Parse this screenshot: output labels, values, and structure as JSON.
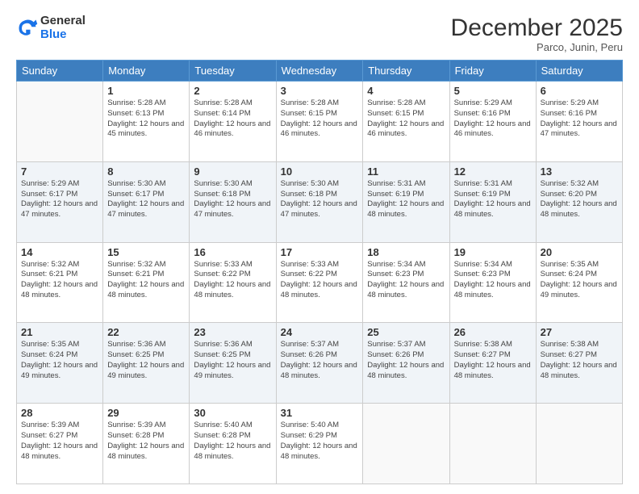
{
  "logo": {
    "general": "General",
    "blue": "Blue"
  },
  "header": {
    "title": "December 2025",
    "subtitle": "Parco, Junin, Peru"
  },
  "weekdays": [
    "Sunday",
    "Monday",
    "Tuesday",
    "Wednesday",
    "Thursday",
    "Friday",
    "Saturday"
  ],
  "weeks": [
    [
      {
        "day": "",
        "sunrise": "",
        "sunset": "",
        "daylight": ""
      },
      {
        "day": "1",
        "sunrise": "Sunrise: 5:28 AM",
        "sunset": "Sunset: 6:13 PM",
        "daylight": "Daylight: 12 hours and 45 minutes."
      },
      {
        "day": "2",
        "sunrise": "Sunrise: 5:28 AM",
        "sunset": "Sunset: 6:14 PM",
        "daylight": "Daylight: 12 hours and 46 minutes."
      },
      {
        "day": "3",
        "sunrise": "Sunrise: 5:28 AM",
        "sunset": "Sunset: 6:15 PM",
        "daylight": "Daylight: 12 hours and 46 minutes."
      },
      {
        "day": "4",
        "sunrise": "Sunrise: 5:28 AM",
        "sunset": "Sunset: 6:15 PM",
        "daylight": "Daylight: 12 hours and 46 minutes."
      },
      {
        "day": "5",
        "sunrise": "Sunrise: 5:29 AM",
        "sunset": "Sunset: 6:16 PM",
        "daylight": "Daylight: 12 hours and 46 minutes."
      },
      {
        "day": "6",
        "sunrise": "Sunrise: 5:29 AM",
        "sunset": "Sunset: 6:16 PM",
        "daylight": "Daylight: 12 hours and 47 minutes."
      }
    ],
    [
      {
        "day": "7",
        "sunrise": "Sunrise: 5:29 AM",
        "sunset": "Sunset: 6:17 PM",
        "daylight": "Daylight: 12 hours and 47 minutes."
      },
      {
        "day": "8",
        "sunrise": "Sunrise: 5:30 AM",
        "sunset": "Sunset: 6:17 PM",
        "daylight": "Daylight: 12 hours and 47 minutes."
      },
      {
        "day": "9",
        "sunrise": "Sunrise: 5:30 AM",
        "sunset": "Sunset: 6:18 PM",
        "daylight": "Daylight: 12 hours and 47 minutes."
      },
      {
        "day": "10",
        "sunrise": "Sunrise: 5:30 AM",
        "sunset": "Sunset: 6:18 PM",
        "daylight": "Daylight: 12 hours and 47 minutes."
      },
      {
        "day": "11",
        "sunrise": "Sunrise: 5:31 AM",
        "sunset": "Sunset: 6:19 PM",
        "daylight": "Daylight: 12 hours and 48 minutes."
      },
      {
        "day": "12",
        "sunrise": "Sunrise: 5:31 AM",
        "sunset": "Sunset: 6:19 PM",
        "daylight": "Daylight: 12 hours and 48 minutes."
      },
      {
        "day": "13",
        "sunrise": "Sunrise: 5:32 AM",
        "sunset": "Sunset: 6:20 PM",
        "daylight": "Daylight: 12 hours and 48 minutes."
      }
    ],
    [
      {
        "day": "14",
        "sunrise": "Sunrise: 5:32 AM",
        "sunset": "Sunset: 6:21 PM",
        "daylight": "Daylight: 12 hours and 48 minutes."
      },
      {
        "day": "15",
        "sunrise": "Sunrise: 5:32 AM",
        "sunset": "Sunset: 6:21 PM",
        "daylight": "Daylight: 12 hours and 48 minutes."
      },
      {
        "day": "16",
        "sunrise": "Sunrise: 5:33 AM",
        "sunset": "Sunset: 6:22 PM",
        "daylight": "Daylight: 12 hours and 48 minutes."
      },
      {
        "day": "17",
        "sunrise": "Sunrise: 5:33 AM",
        "sunset": "Sunset: 6:22 PM",
        "daylight": "Daylight: 12 hours and 48 minutes."
      },
      {
        "day": "18",
        "sunrise": "Sunrise: 5:34 AM",
        "sunset": "Sunset: 6:23 PM",
        "daylight": "Daylight: 12 hours and 48 minutes."
      },
      {
        "day": "19",
        "sunrise": "Sunrise: 5:34 AM",
        "sunset": "Sunset: 6:23 PM",
        "daylight": "Daylight: 12 hours and 48 minutes."
      },
      {
        "day": "20",
        "sunrise": "Sunrise: 5:35 AM",
        "sunset": "Sunset: 6:24 PM",
        "daylight": "Daylight: 12 hours and 49 minutes."
      }
    ],
    [
      {
        "day": "21",
        "sunrise": "Sunrise: 5:35 AM",
        "sunset": "Sunset: 6:24 PM",
        "daylight": "Daylight: 12 hours and 49 minutes."
      },
      {
        "day": "22",
        "sunrise": "Sunrise: 5:36 AM",
        "sunset": "Sunset: 6:25 PM",
        "daylight": "Daylight: 12 hours and 49 minutes."
      },
      {
        "day": "23",
        "sunrise": "Sunrise: 5:36 AM",
        "sunset": "Sunset: 6:25 PM",
        "daylight": "Daylight: 12 hours and 49 minutes."
      },
      {
        "day": "24",
        "sunrise": "Sunrise: 5:37 AM",
        "sunset": "Sunset: 6:26 PM",
        "daylight": "Daylight: 12 hours and 48 minutes."
      },
      {
        "day": "25",
        "sunrise": "Sunrise: 5:37 AM",
        "sunset": "Sunset: 6:26 PM",
        "daylight": "Daylight: 12 hours and 48 minutes."
      },
      {
        "day": "26",
        "sunrise": "Sunrise: 5:38 AM",
        "sunset": "Sunset: 6:27 PM",
        "daylight": "Daylight: 12 hours and 48 minutes."
      },
      {
        "day": "27",
        "sunrise": "Sunrise: 5:38 AM",
        "sunset": "Sunset: 6:27 PM",
        "daylight": "Daylight: 12 hours and 48 minutes."
      }
    ],
    [
      {
        "day": "28",
        "sunrise": "Sunrise: 5:39 AM",
        "sunset": "Sunset: 6:27 PM",
        "daylight": "Daylight: 12 hours and 48 minutes."
      },
      {
        "day": "29",
        "sunrise": "Sunrise: 5:39 AM",
        "sunset": "Sunset: 6:28 PM",
        "daylight": "Daylight: 12 hours and 48 minutes."
      },
      {
        "day": "30",
        "sunrise": "Sunrise: 5:40 AM",
        "sunset": "Sunset: 6:28 PM",
        "daylight": "Daylight: 12 hours and 48 minutes."
      },
      {
        "day": "31",
        "sunrise": "Sunrise: 5:40 AM",
        "sunset": "Sunset: 6:29 PM",
        "daylight": "Daylight: 12 hours and 48 minutes."
      },
      {
        "day": "",
        "sunrise": "",
        "sunset": "",
        "daylight": ""
      },
      {
        "day": "",
        "sunrise": "",
        "sunset": "",
        "daylight": ""
      },
      {
        "day": "",
        "sunrise": "",
        "sunset": "",
        "daylight": ""
      }
    ]
  ]
}
